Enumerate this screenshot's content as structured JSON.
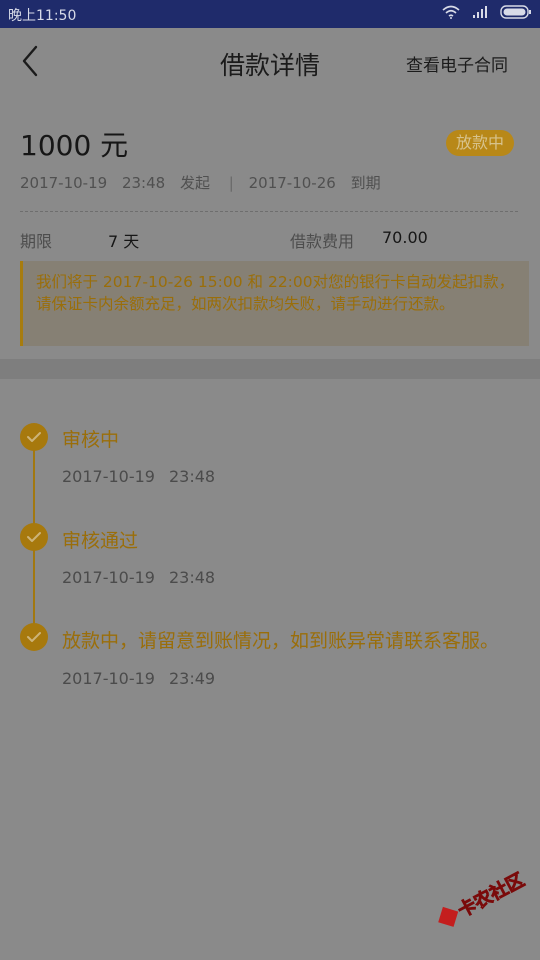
{
  "status_bar": {
    "time": "晚上11:50"
  },
  "header": {
    "title": "借款详情",
    "contract_link": "查看电子合同"
  },
  "summary": {
    "amount": "1000 元",
    "status_badge": "放款中",
    "start_date": "2017-10-19",
    "start_time": "23:48",
    "start_label": "发起",
    "separator": "|",
    "due_date": "2017-10-26",
    "due_label": "到期",
    "term_label": "期限",
    "term_value": "7 天",
    "fee_label": "借款费用",
    "fee_value": "70.00"
  },
  "notice": {
    "text": "我们将于 2017-10-26 15:00 和 22:00对您的银行卡自动发起扣款，请保证卡内余额充足，如两次扣款均失败，请手动进行还款。"
  },
  "timeline": [
    {
      "title": "审核中",
      "date": "2017-10-19",
      "time": "23:48"
    },
    {
      "title": "审核通过",
      "date": "2017-10-19",
      "time": "23:48"
    },
    {
      "title": "放款中，请留意到账情况，如到账异常请联系客服。",
      "date": "2017-10-19",
      "time": "23:49"
    }
  ],
  "watermark": {
    "text": "卡农社区"
  },
  "colors": {
    "accent": "#a7790d",
    "status_bar": "#1f2b6b",
    "overlay_bg": "#8a8a8a"
  }
}
